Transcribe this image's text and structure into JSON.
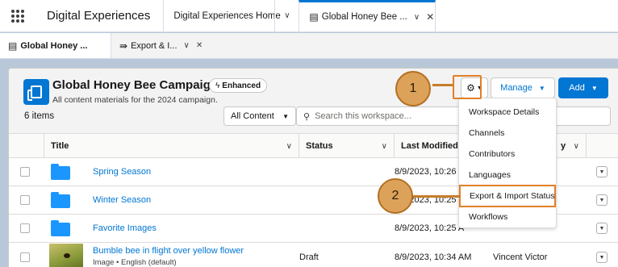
{
  "app": {
    "name": "Digital Experiences"
  },
  "tabs": [
    {
      "label": "Digital Experiences Home"
    },
    {
      "label": "Global Honey Bee ..."
    }
  ],
  "subtabs": [
    {
      "label": "Global Honey ..."
    },
    {
      "label": "Export & I..."
    }
  ],
  "workspace": {
    "title": "Global Honey Bee Campaign",
    "badge": "Enhanced",
    "description": "All content materials for the 2024 campaign.",
    "item_count": "6 items",
    "filter": "All Content",
    "search_placeholder": "Search this workspace..."
  },
  "buttons": {
    "manage": "Manage",
    "add": "Add"
  },
  "table": {
    "columns": [
      "Title",
      "Status",
      "Last Modified D...",
      "y"
    ],
    "rows": [
      {
        "title": "Spring Season",
        "status": "",
        "modified": "8/9/2023, 10:26 A",
        "by": ""
      },
      {
        "title": "Winter Season",
        "status": "",
        "modified": "8/9/2023, 10:25",
        "by": ""
      },
      {
        "title": "Favorite Images",
        "status": "",
        "modified": "8/9/2023, 10:25 A",
        "by": ""
      },
      {
        "title": "Bumble bee in flight over yellow flower",
        "meta": "Image • English (default)",
        "status": "Draft",
        "modified": "8/9/2023, 10:34 AM",
        "by": "Vincent Victor"
      }
    ]
  },
  "manage_menu": [
    "Workspace Details",
    "Channels",
    "Contributors",
    "Languages",
    "Export & Import Status",
    "Workflows"
  ],
  "callouts": [
    "1",
    "2"
  ],
  "colors": {
    "brand": "#0176d3",
    "highlight": "#e27f27",
    "callout": "#dda25a"
  }
}
